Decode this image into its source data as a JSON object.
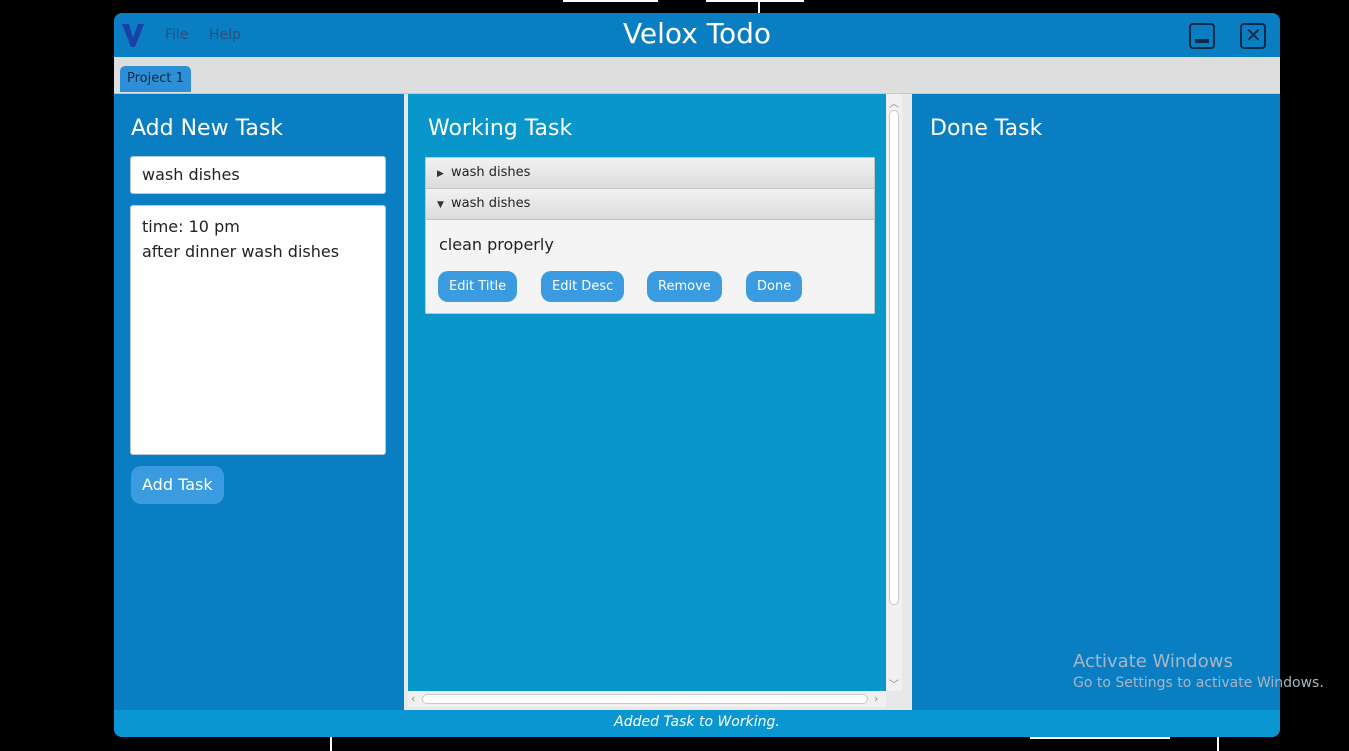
{
  "window": {
    "title": "Velox Todo",
    "menu": [
      "File",
      "Help"
    ],
    "tabs": [
      "Project 1"
    ],
    "status": "Added Task to Working."
  },
  "add_panel": {
    "heading": "Add New Task",
    "title_value": "wash dishes",
    "desc_lines": [
      "time: 10 pm",
      "after dinner wash dishes"
    ],
    "add_button": "Add Task"
  },
  "working_panel": {
    "heading": "Working Task",
    "tasks": [
      {
        "title": "wash dishes",
        "expanded": false
      },
      {
        "title": "wash dishes",
        "expanded": true,
        "description": "clean properly"
      }
    ],
    "buttons": [
      "Edit Title",
      "Edit Desc",
      "Remove",
      "Done"
    ]
  },
  "done_panel": {
    "heading": "Done Task"
  },
  "watermark": {
    "line1": "Activate Windows",
    "line2": "Go to Settings to activate Windows."
  },
  "icons": {
    "logo": "velox-v-logo",
    "minimize": "minimize-icon",
    "close": "close-icon",
    "collapsed": "triangle-right-icon",
    "expanded": "triangle-down-icon"
  },
  "colors": {
    "window_bg": "#0a7ec2",
    "working_bg": "#0996cb",
    "button": "#3a9be0",
    "status_bar": "#0a96d1"
  }
}
